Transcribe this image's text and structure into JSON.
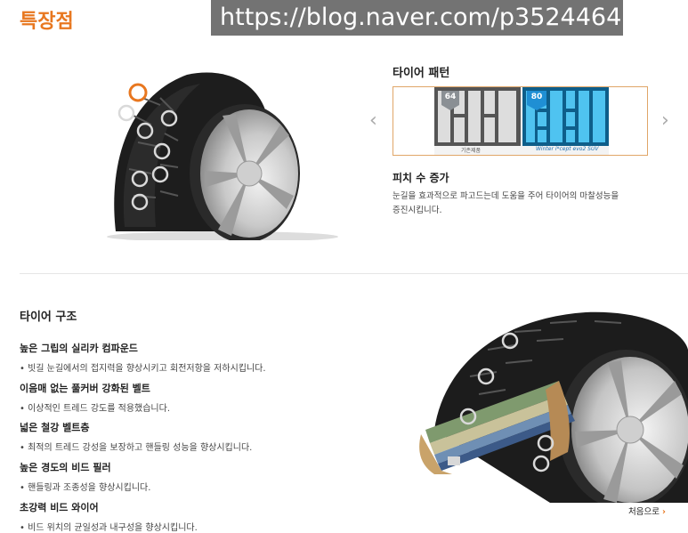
{
  "page": {
    "title": "특장점",
    "watermark": "https://blog.naver.com/p3524464"
  },
  "tread": {
    "label": "타이어 패턴",
    "left_badge": "64",
    "right_badge": "80",
    "left_caption": "기존제품",
    "right_caption": "Winter i*cept evo2 SUV"
  },
  "pitch": {
    "title": "피치 수 증가",
    "desc_line1": "눈길을 효과적으로 파고드는데 도움을 주어 타이어의 마찰성능을",
    "desc_line2": "증진시킵니다."
  },
  "structure": {
    "title": "타이어 구조",
    "features": [
      {
        "heading": "높은 그립의 실리카 컴파운드",
        "desc": "• 빗길 눈길에서의 접지력을 향상시키고 회전저항을 저하시킵니다."
      },
      {
        "heading": "이음매 없는 풀커버 강화된 벨트",
        "desc": "• 이상적인 트레드 강도를 적용했습니다."
      },
      {
        "heading": "넓은 철강 벨트층",
        "desc": "• 최적의 트레드 강성을 보장하고 핸들링 성능을 향상시킵니다."
      },
      {
        "heading": "높은 경도의 비드 필러",
        "desc": "• 핸들링과 조종성을 향상시킵니다."
      },
      {
        "heading": "초강력 비드 와이어",
        "desc": "• 비드 위치의 균일성과 내구성을 향상시킵니다."
      }
    ]
  },
  "nav": {
    "first_label": "처음으로",
    "prev_icon": "chevron-left-icon",
    "next_icon": "chevron-right-icon"
  },
  "colors": {
    "accent": "#e8771f",
    "badge_left": "#8a8f94",
    "badge_right": "#1f8fd4"
  }
}
